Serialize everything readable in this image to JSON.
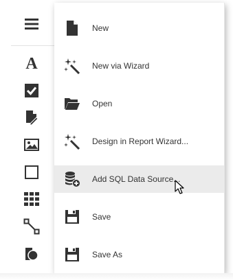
{
  "toolbox": {
    "items": [
      {
        "icon": "hamburger-menu-icon"
      },
      {
        "icon": "label-icon",
        "glyph": "A"
      },
      {
        "icon": "checkbox-icon"
      },
      {
        "icon": "rich-text-icon"
      },
      {
        "icon": "picture-box-icon"
      },
      {
        "icon": "panel-icon"
      },
      {
        "icon": "table-icon"
      },
      {
        "icon": "line-icon"
      },
      {
        "icon": "shape-icon"
      }
    ]
  },
  "menu": {
    "items": [
      {
        "label": "New",
        "icon": "new-document-icon"
      },
      {
        "label": "New via Wizard",
        "icon": "wizard-wand-icon"
      },
      {
        "label": "Open",
        "icon": "folder-open-icon"
      },
      {
        "label": "Design in Report Wizard...",
        "icon": "wizard-wand-icon"
      },
      {
        "label": "Add SQL Data Source...",
        "icon": "add-data-source-icon"
      },
      {
        "label": "Save",
        "icon": "floppy-disk-icon"
      },
      {
        "label": "Save As",
        "icon": "floppy-disk-icon"
      }
    ],
    "hovered_index": 4
  },
  "colors": {
    "icon": "#333333",
    "text": "#333333",
    "hover_background": "#ebebeb"
  }
}
